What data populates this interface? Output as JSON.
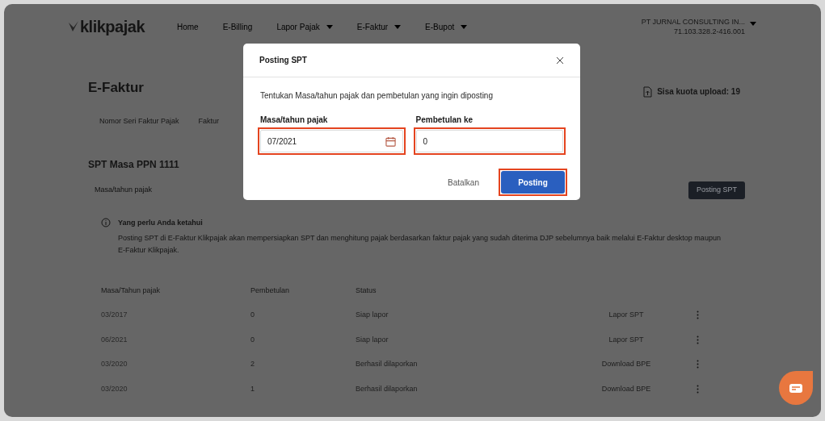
{
  "logo": {
    "text": "klikpajak"
  },
  "nav": [
    {
      "label": "Home",
      "dropdown": false
    },
    {
      "label": "E-Billing",
      "dropdown": false
    },
    {
      "label": "Lapor Pajak",
      "dropdown": true
    },
    {
      "label": "E-Faktur",
      "dropdown": true
    },
    {
      "label": "E-Bupot",
      "dropdown": true
    }
  ],
  "account": {
    "company": "PT JURNAL CONSULTING IN...",
    "npwp": "71.103.328.2-416.001"
  },
  "page_title": "E-Faktur",
  "quota": "Sisa kuota upload: 19",
  "tabs": [
    "Nomor Seri Faktur Pajak",
    "Faktur"
  ],
  "section_title": "SPT Masa PPN 1111",
  "period_field": {
    "placeholder": "Masa/tahun pajak"
  },
  "posting_button": "Posting SPT",
  "info": {
    "title": "Yang perlu Anda ketahui",
    "text": "Posting SPT di E-Faktur Klikpajak akan mempersiapkan SPT dan menghitung pajak berdasarkan faktur pajak yang sudah diterima DJP sebelumnya baik melalui E-Faktur desktop maupun E-Faktur Klikpajak."
  },
  "table": {
    "columns": [
      "Masa/Tahun pajak",
      "Pembetulan",
      "Status"
    ],
    "rows": [
      {
        "period": "03/2017",
        "revision": "0",
        "status": "Siap lapor",
        "action": "Lapor SPT"
      },
      {
        "period": "06/2021",
        "revision": "0",
        "status": "Siap lapor",
        "action": "Lapor SPT"
      },
      {
        "period": "03/2020",
        "revision": "2",
        "status": "Berhasil dilaporkan",
        "action": "Download BPE"
      },
      {
        "period": "03/2020",
        "revision": "1",
        "status": "Berhasil dilaporkan",
        "action": "Download BPE"
      }
    ]
  },
  "dialog": {
    "title": "Posting SPT",
    "description": "Tentukan Masa/tahun pajak dan pembetulan yang ingin diposting",
    "fields": [
      {
        "kind": "date",
        "label": "Masa/tahun pajak",
        "value": "07/2021",
        "highlighted": true
      },
      {
        "kind": "text",
        "label": "Pembetulan ke",
        "value": "0",
        "highlighted": true
      }
    ],
    "cancel": "Batalkan",
    "confirm": {
      "label": "Posting",
      "highlighted": true
    }
  }
}
